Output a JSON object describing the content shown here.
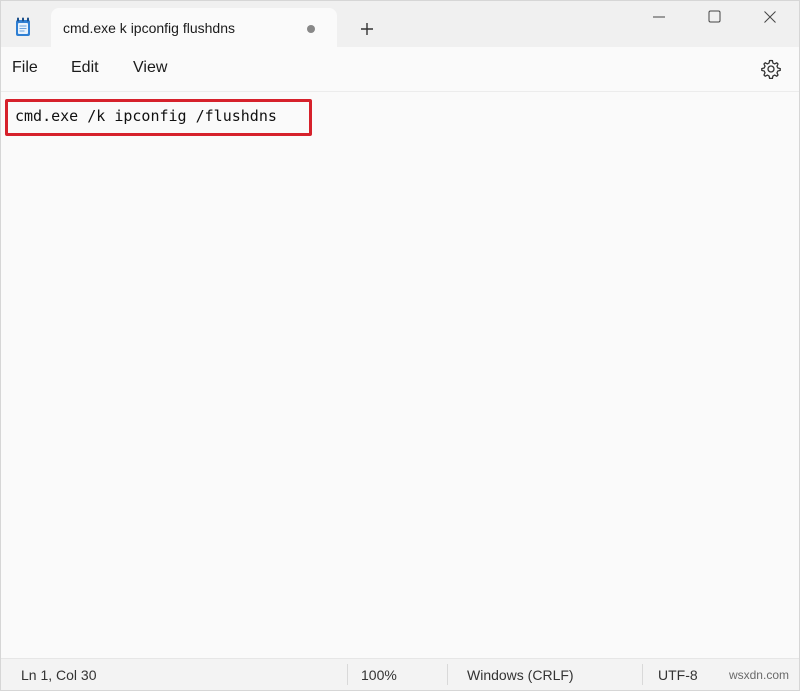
{
  "window": {
    "tab_title": "cmd.exe k ipconfig flushdns",
    "new_tab_icon": "plus-icon",
    "app_icon": "notepad-icon",
    "controls": [
      "minimize-icon",
      "maximize-icon",
      "close-icon"
    ]
  },
  "menu": {
    "file": "File",
    "edit": "Edit",
    "view": "View",
    "settings_icon": "gear-icon"
  },
  "editor": {
    "line1": "cmd.exe /k ipconfig /flushdns",
    "highlight_color": "#d6212b"
  },
  "status": {
    "position": "Ln 1, Col 30",
    "zoom": "100%",
    "line_ending": "Windows (CRLF)",
    "encoding": "UTF-8",
    "watermark": "wsxdn.com"
  }
}
